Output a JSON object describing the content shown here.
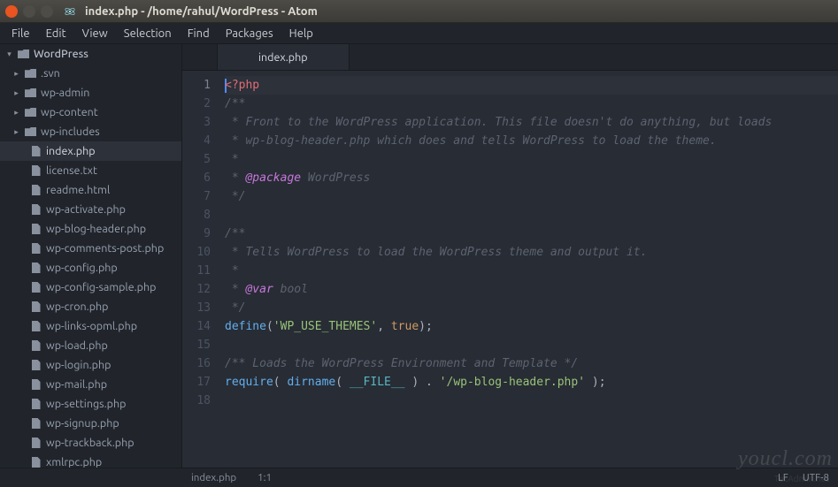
{
  "titlebar": {
    "title": "index.php - /home/rahul/WordPress - Atom"
  },
  "menu": {
    "items": [
      "File",
      "Edit",
      "View",
      "Selection",
      "Find",
      "Packages",
      "Help"
    ]
  },
  "sidebar": {
    "project": "WordPress",
    "folders": [
      ".svn",
      "wp-admin",
      "wp-content",
      "wp-includes"
    ],
    "files": [
      "index.php",
      "license.txt",
      "readme.html",
      "wp-activate.php",
      "wp-blog-header.php",
      "wp-comments-post.php",
      "wp-config.php",
      "wp-config-sample.php",
      "wp-cron.php",
      "wp-links-opml.php",
      "wp-load.php",
      "wp-login.php",
      "wp-mail.php",
      "wp-settings.php",
      "wp-signup.php",
      "wp-trackback.php",
      "xmlrpc.php"
    ],
    "selected": "index.php"
  },
  "tabs": {
    "active": "index.php"
  },
  "code": {
    "lines": [
      [
        {
          "c": "tk-tag",
          "t": "<?php"
        }
      ],
      [
        {
          "c": "tk-comment",
          "t": "/**"
        }
      ],
      [
        {
          "c": "tk-comment",
          "t": " * Front to the WordPress application. This file doesn't do anything, but loads"
        }
      ],
      [
        {
          "c": "tk-comment",
          "t": " * wp-blog-header.php which does and tells WordPress to load the theme."
        }
      ],
      [
        {
          "c": "tk-comment",
          "t": " *"
        }
      ],
      [
        {
          "c": "tk-comment",
          "t": " * "
        },
        {
          "c": "tk-doctag",
          "t": "@package"
        },
        {
          "c": "tk-dockw",
          "t": " WordPress"
        }
      ],
      [
        {
          "c": "tk-comment",
          "t": " */"
        }
      ],
      [],
      [
        {
          "c": "tk-comment",
          "t": "/**"
        }
      ],
      [
        {
          "c": "tk-comment",
          "t": " * Tells WordPress to load the WordPress theme and output it."
        }
      ],
      [
        {
          "c": "tk-comment",
          "t": " *"
        }
      ],
      [
        {
          "c": "tk-comment",
          "t": " * "
        },
        {
          "c": "tk-doctag",
          "t": "@var"
        },
        {
          "c": "tk-dockw",
          "t": " bool"
        }
      ],
      [
        {
          "c": "tk-comment",
          "t": " */"
        }
      ],
      [
        {
          "c": "tk-func",
          "t": "define"
        },
        {
          "c": "tk-punc",
          "t": "("
        },
        {
          "c": "tk-str",
          "t": "'WP_USE_THEMES'"
        },
        {
          "c": "tk-punc",
          "t": ", "
        },
        {
          "c": "tk-const",
          "t": "true"
        },
        {
          "c": "tk-punc",
          "t": ");"
        }
      ],
      [],
      [
        {
          "c": "tk-comment",
          "t": "/** Loads the WordPress Environment and Template */"
        }
      ],
      [
        {
          "c": "tk-func",
          "t": "require"
        },
        {
          "c": "tk-punc",
          "t": "( "
        },
        {
          "c": "tk-func",
          "t": "dirname"
        },
        {
          "c": "tk-punc",
          "t": "( "
        },
        {
          "c": "tk-magic",
          "t": "__FILE__"
        },
        {
          "c": "tk-punc",
          "t": " ) . "
        },
        {
          "c": "tk-str",
          "t": "'/wp-blog-header.php'"
        },
        {
          "c": "tk-punc",
          "t": " );"
        }
      ],
      []
    ],
    "current_line": 1
  },
  "statusbar": {
    "file": "index.php",
    "pos": "1:1",
    "encoding": "UTF-8",
    "eol": "LF"
  },
  "watermark": "youcl.com",
  "watermark2": "TecAdmin.net"
}
